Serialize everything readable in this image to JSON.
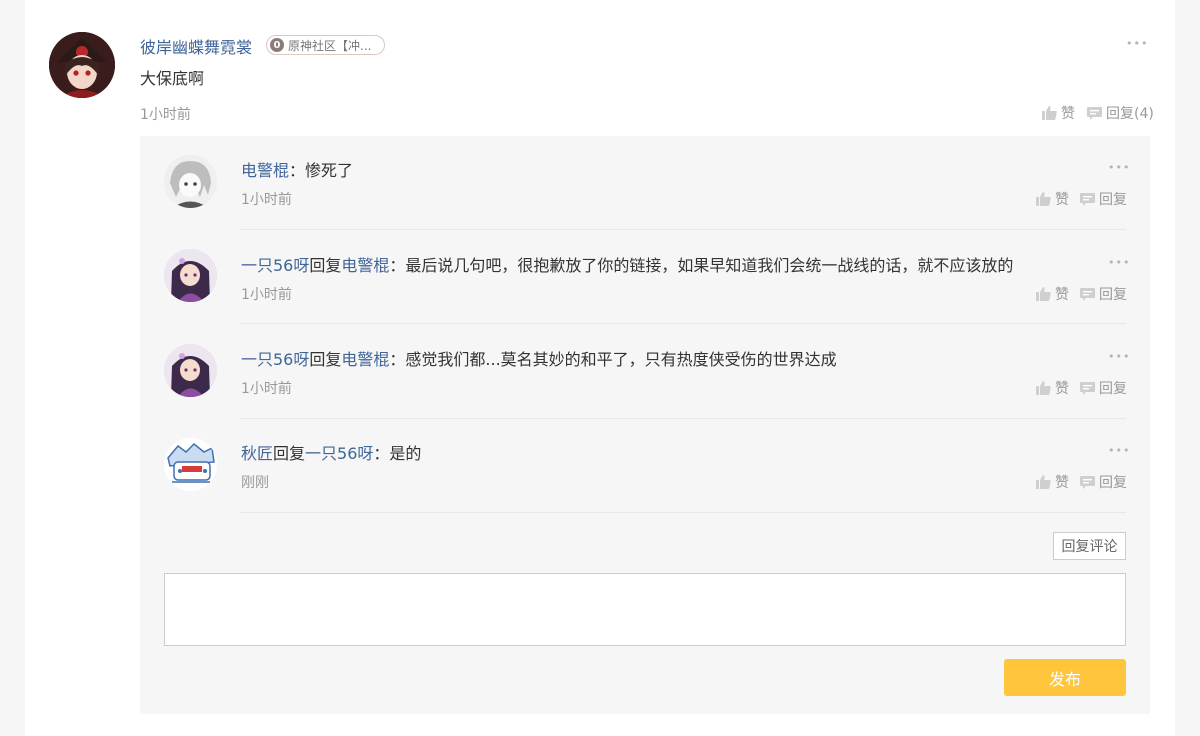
{
  "colors": {
    "name": "#406599",
    "muted": "#999999",
    "publish": "#ffc53d"
  },
  "main_comment": {
    "username": "彼岸幽蝶舞霓裳",
    "level": "0",
    "badge": "原神社区【冲...",
    "text": "大保底啊",
    "time": "1小时前",
    "like_label": "赞",
    "reply_label": "回复(4)",
    "more": "•••"
  },
  "replies": [
    {
      "user": "电警棍",
      "reply_word": "",
      "target": "",
      "sep": "：",
      "text": "惨死了",
      "time": "1小时前",
      "like": "赞",
      "reply": "回复",
      "more": "•••"
    },
    {
      "user": "一￼只56呀",
      "reply_word": "回复",
      "target": "电警棍",
      "sep": "：",
      "text": "最后说几句吧，很抱歉放了你的链接，如果早知道我们会统一战线的话，就不应该放的",
      "time": "1小时前",
      "like": "赞",
      "reply": "回复",
      "more": "•••"
    },
    {
      "user": "一￼只56呀",
      "reply_word": "回复",
      "target": "电警棍",
      "sep": "：",
      "text": "感觉我们都...莫名其妙的和平了，只有热度侠受伤的世界达成",
      "time": "1小时前",
      "like": "赞",
      "reply": "回复",
      "more": "•••"
    },
    {
      "user": "秋匠",
      "reply_word": "回复",
      "target": "一￼只56呀",
      "sep": "：",
      "text": "是的",
      "time": "刚刚",
      "like": "赞",
      "reply": "回复",
      "more": "•••"
    }
  ],
  "reply_comment_button": "回复评论",
  "textarea_value": "",
  "publish_button": "发布"
}
